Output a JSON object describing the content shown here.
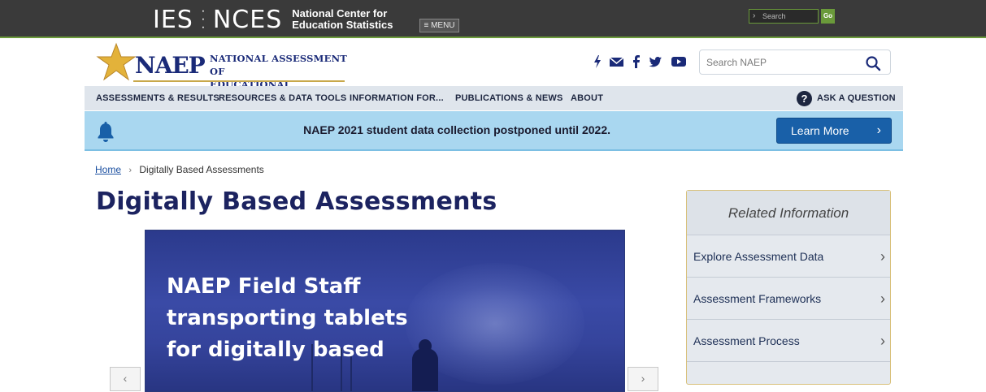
{
  "ies_bar": {
    "logo_left": "IES",
    "logo_right": "NCES",
    "title_line1": "National Center for",
    "title_line2": "Education Statistics",
    "menu_label": "≡ MENU",
    "search_placeholder": "Search",
    "go_label": "Go",
    "accent_color": "#6a9a3a"
  },
  "header": {
    "logo_word": "NAEP",
    "logo_line1": "NATIONAL ASSESSMENT OF",
    "logo_line2": "EDUCATIONAL PROGRESS",
    "brand_color": "#1a2a78",
    "social_icons": [
      "flash-icon",
      "email-icon",
      "facebook-icon",
      "twitter-icon",
      "youtube-icon"
    ],
    "search_placeholder": "Search NAEP"
  },
  "nav": {
    "items": [
      {
        "label": "ASSESSMENTS & RESULTS"
      },
      {
        "label": "RESOURCES & DATA TOOLS"
      },
      {
        "label": "INFORMATION FOR..."
      },
      {
        "label": "PUBLICATIONS & NEWS"
      },
      {
        "label": "ABOUT"
      }
    ],
    "ask_label": "ASK A QUESTION"
  },
  "alert": {
    "message": "NAEP 2021 student data collection postponed until 2022.",
    "button_label": "Learn More",
    "background": "#a9d7f0",
    "button_color": "#1960a8"
  },
  "breadcrumb": {
    "home": "Home",
    "current": "Digitally Based Assessments"
  },
  "page": {
    "title": "Digitally Based Assessments"
  },
  "slide": {
    "caption": "NAEP Field Staff transporting tablets for digitally based"
  },
  "related": {
    "heading": "Related Information",
    "items": [
      {
        "label": "Explore Assessment Data"
      },
      {
        "label": "Assessment Frameworks"
      },
      {
        "label": "Assessment Process"
      }
    ]
  }
}
